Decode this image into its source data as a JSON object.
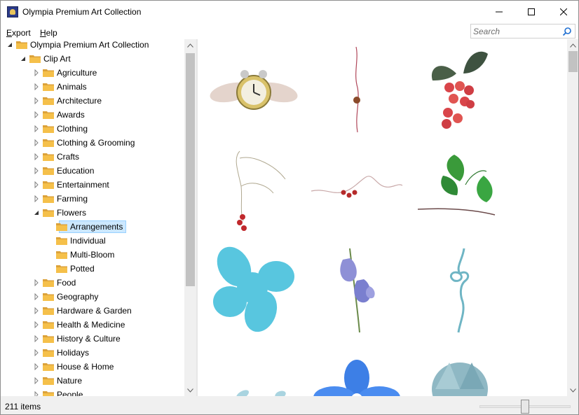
{
  "window": {
    "title": "Olympia Premium Art Collection",
    "minimize_icon": "minimize-icon",
    "maximize_icon": "maximize-icon",
    "close_icon": "close-icon"
  },
  "menu": {
    "export_label": "Export",
    "help_label": "Help"
  },
  "search": {
    "placeholder": "Search"
  },
  "tree": {
    "root": "Olympia Premium Art Collection",
    "clip_art": "Clip Art",
    "categories": [
      "Agriculture",
      "Animals",
      "Architecture",
      "Awards",
      "Clothing",
      "Clothing & Grooming",
      "Crafts",
      "Education",
      "Entertainment",
      "Farming",
      "Flowers"
    ],
    "flower_children": [
      "Arrangements",
      "Individual",
      "Multi-Bloom",
      "Potted"
    ],
    "selected": "Arrangements",
    "categories_after": [
      "Food",
      "Geography",
      "Hardware & Garden",
      "Health & Medicine",
      "History & Culture",
      "Holidays",
      "House & Home",
      "Nature",
      "People"
    ]
  },
  "gallery": {
    "items": [
      "winged-clock-image",
      "hanging-berry-vine-image",
      "red-berries-leaves-image",
      "curly-vine-red-berries-image",
      "wavy-vine-berries-image",
      "green-leaves-twig-image",
      "blue-flower-shape-image",
      "bluebell-flowers-image",
      "blue-twine-bow-image",
      "blue-leaf-sprig-image",
      "blue-star-flower-image",
      "shell-bouquet-image"
    ]
  },
  "status": {
    "item_count": "211 items",
    "zoom_level": 0.5
  },
  "colors": {
    "selection": "#cce8ff",
    "folder": "#f5c04a",
    "scrollbar_thumb": "#c2c2c2"
  }
}
